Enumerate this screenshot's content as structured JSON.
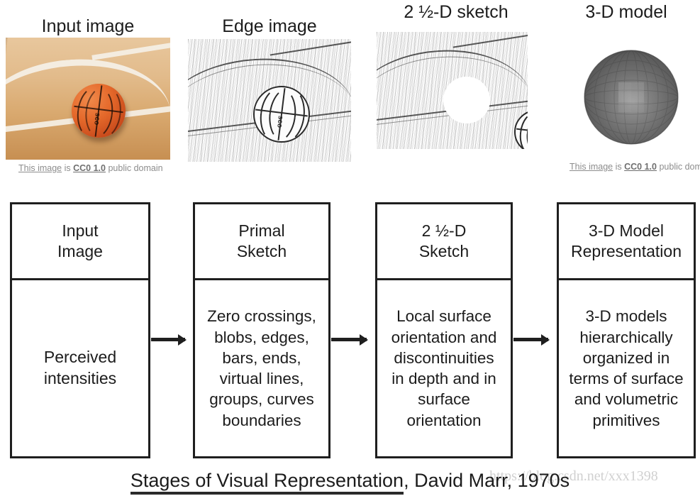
{
  "columns": [
    {
      "title": "Input image",
      "icon": "photo-basketball-court-icon"
    },
    {
      "title": "Edge image",
      "icon": "edge-filtered-image-icon"
    },
    {
      "title": "2 ½-D sketch",
      "icon": "depth-sketch-image-icon"
    },
    {
      "title": "3-D model",
      "icon": "shaded-sphere-icon"
    }
  ],
  "attributions": {
    "left": {
      "link1": "This image",
      "mid": " is ",
      "link2": "CC0 1.0",
      "tail": " public domain"
    },
    "right": {
      "link1": "This image",
      "mid": " is ",
      "link2": "CC0 1.0",
      "tail": " public domai"
    }
  },
  "flow": {
    "boxes": [
      {
        "header": "Input\nImage",
        "body": "Perceived\nintensities"
      },
      {
        "header": "Primal\nSketch",
        "body": "Zero crossings,\nblobs, edges,\nbars, ends,\nvirtual lines,\ngroups, curves\nboundaries"
      },
      {
        "header": "2 ½-D\nSketch",
        "body": "Local surface\norientation and\ndiscontinuities\nin depth and in\nsurface\norientation"
      },
      {
        "header": "3-D Model\nRepresentation",
        "body": "3-D models\nhierarchically\norganized in\nterms of surface\nand volumetric\nprimitives"
      }
    ],
    "arrow_icon": "right-arrow-icon"
  },
  "caption": {
    "underlined": "Stages of Visual Representation",
    "rest": ", David Marr, 1970s"
  },
  "watermark": "https://blog.csdn.net/xxx1398",
  "colors": {
    "border": "#1f1f1f",
    "text": "#1c1c1c",
    "attribution": "#8d8d8d",
    "ball_orange": "#e4682a",
    "court_wood": "#e2bb8b",
    "sphere_gray": "#6a6a6a"
  }
}
